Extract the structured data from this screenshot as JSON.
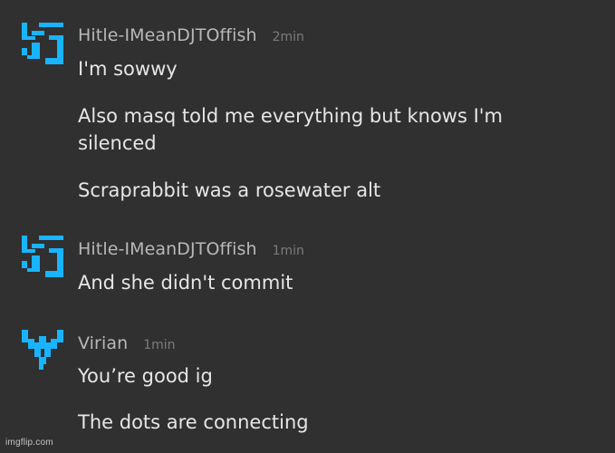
{
  "colors": {
    "background": "#303030",
    "avatar_blue": "#19b4ff",
    "username": "#b8b8b8",
    "timestamp": "#7c7c7c",
    "message_text": "#e6e6e6"
  },
  "messages": [
    {
      "username": "Hitle-IMeanDJTOffish",
      "time": "2min",
      "avatar_icon": "blue-pixel-avatar-icon",
      "lines": [
        "I'm sowwy",
        "Also masq told me everything but knows I'm",
        "silenced",
        "Scraprabbit was a rosewater alt"
      ]
    },
    {
      "username": "Hitle-IMeanDJTOffish",
      "time": "1min",
      "avatar_icon": "blue-pixel-avatar-icon",
      "lines": [
        "And she didn't commit"
      ]
    },
    {
      "username": "Virian",
      "time": "1min",
      "avatar_icon": "blue-pixel-avatar-icon",
      "lines": [
        "You’re good ig",
        "The dots are connecting"
      ]
    }
  ],
  "watermark": "imgflip.com"
}
